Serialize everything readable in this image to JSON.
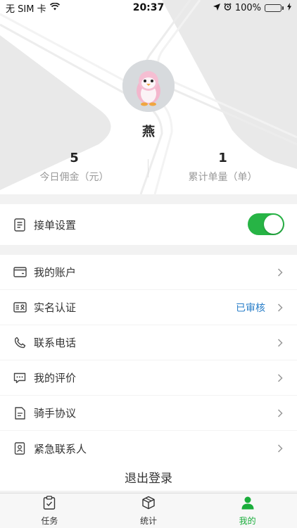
{
  "status_bar": {
    "carrier": "无 SIM 卡",
    "time": "20:37",
    "battery_percent": "100%",
    "battery_level": 1.0
  },
  "profile": {
    "name": "燕",
    "stats": [
      {
        "value": "5",
        "label": "今日佣金（元）"
      },
      {
        "value": "1",
        "label": "累计单量（单）"
      }
    ]
  },
  "settings": {
    "order_settings_label": "接单设置",
    "order_toggle_on": true
  },
  "menu": {
    "items": [
      {
        "label": "我的账户",
        "icon": "wallet-icon"
      },
      {
        "label": "实名认证",
        "icon": "id-card-icon",
        "status": "已审核"
      },
      {
        "label": "联系电话",
        "icon": "phone-icon"
      },
      {
        "label": "我的评价",
        "icon": "comment-icon"
      },
      {
        "label": "骑手协议",
        "icon": "agreement-icon"
      },
      {
        "label": "紧急联系人",
        "icon": "contact-icon"
      }
    ]
  },
  "logout_label": "退出登录",
  "tabbar": {
    "tabs": [
      {
        "label": "任务",
        "icon": "clipboard-icon"
      },
      {
        "label": "统计",
        "icon": "box-icon"
      },
      {
        "label": "我的",
        "icon": "person-icon",
        "active": true
      }
    ]
  },
  "colors": {
    "accent_green": "#27b445",
    "tab_active": "#1aad3b",
    "status_blue": "#2a7fc9"
  }
}
